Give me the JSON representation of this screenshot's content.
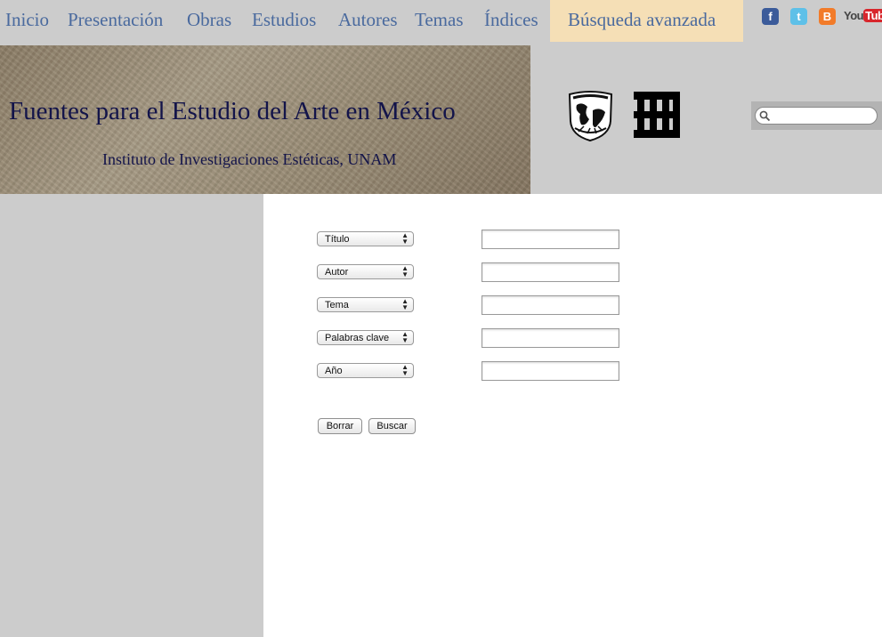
{
  "nav": {
    "items": [
      {
        "label": "Inicio"
      },
      {
        "label": "Presentación"
      },
      {
        "label": "Obras"
      },
      {
        "label": "Estudios"
      },
      {
        "label": "Autores"
      },
      {
        "label": "Temas"
      },
      {
        "label": "Índices"
      }
    ],
    "active": {
      "label": "Búsqueda avanzada"
    },
    "social": [
      {
        "name": "facebook-icon",
        "glyph": "f"
      },
      {
        "name": "twitter-icon",
        "glyph": "t"
      },
      {
        "name": "blogger-icon",
        "glyph": "B"
      }
    ],
    "youtube": {
      "you": "You",
      "tube": "Tube"
    }
  },
  "header": {
    "title": "Fuentes para el Estudio del Arte en México",
    "subtitle": "Instituto de Investigaciones Estéticas, UNAM"
  },
  "search": {
    "placeholder": "",
    "value": ""
  },
  "form": {
    "rows": [
      {
        "field": "Título",
        "value": ""
      },
      {
        "field": "Autor",
        "value": ""
      },
      {
        "field": "Tema",
        "value": ""
      },
      {
        "field": "Palabras clave",
        "value": ""
      },
      {
        "field": "Año",
        "value": ""
      }
    ],
    "clear_label": "Borrar",
    "search_label": "Buscar"
  },
  "colors": {
    "nav_text": "#4a6a9e",
    "active_tab_bg": "#f5dfb6",
    "title_text": "#13144a",
    "page_bg": "#cccccc"
  }
}
